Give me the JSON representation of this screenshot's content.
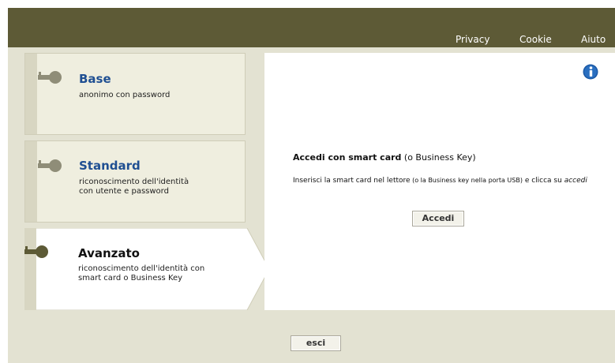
{
  "header": {
    "links": {
      "privacy": "Privacy",
      "cookie": "Cookie",
      "aiuto": "Aiuto"
    }
  },
  "tabs": {
    "base": {
      "title": "Base",
      "desc_line1": "anonimo con password",
      "icon": "key-icon"
    },
    "standard": {
      "title": "Standard",
      "desc_line1": "riconoscimento dell'identità",
      "desc_line2": "con utente e password",
      "icon": "key-icon"
    },
    "avanzato": {
      "title": "Avanzato",
      "desc_line1": "riconoscimento dell'identità con",
      "desc_line2": "smart card o Business Key",
      "icon": "key-icon",
      "selected": true
    }
  },
  "panel": {
    "info_icon": "info-icon",
    "title_bold": "Accedi con smart card",
    "title_rest": " (o Business Key)",
    "text_part1": "Inserisci la smart card nel lettore",
    "text_small": " (o la Business key nella porta USB)",
    "text_part2": " e clicca su ",
    "text_em": "accedi",
    "accedi_label": "Accedi"
  },
  "footer": {
    "esci_label": "esci"
  },
  "colors": {
    "header_bg": "#5d5a36",
    "page_bg": "#e3e2d2",
    "tab_bg": "#efeedf",
    "title_blue": "#1f4f92",
    "info_blue": "#1c5aa6"
  }
}
